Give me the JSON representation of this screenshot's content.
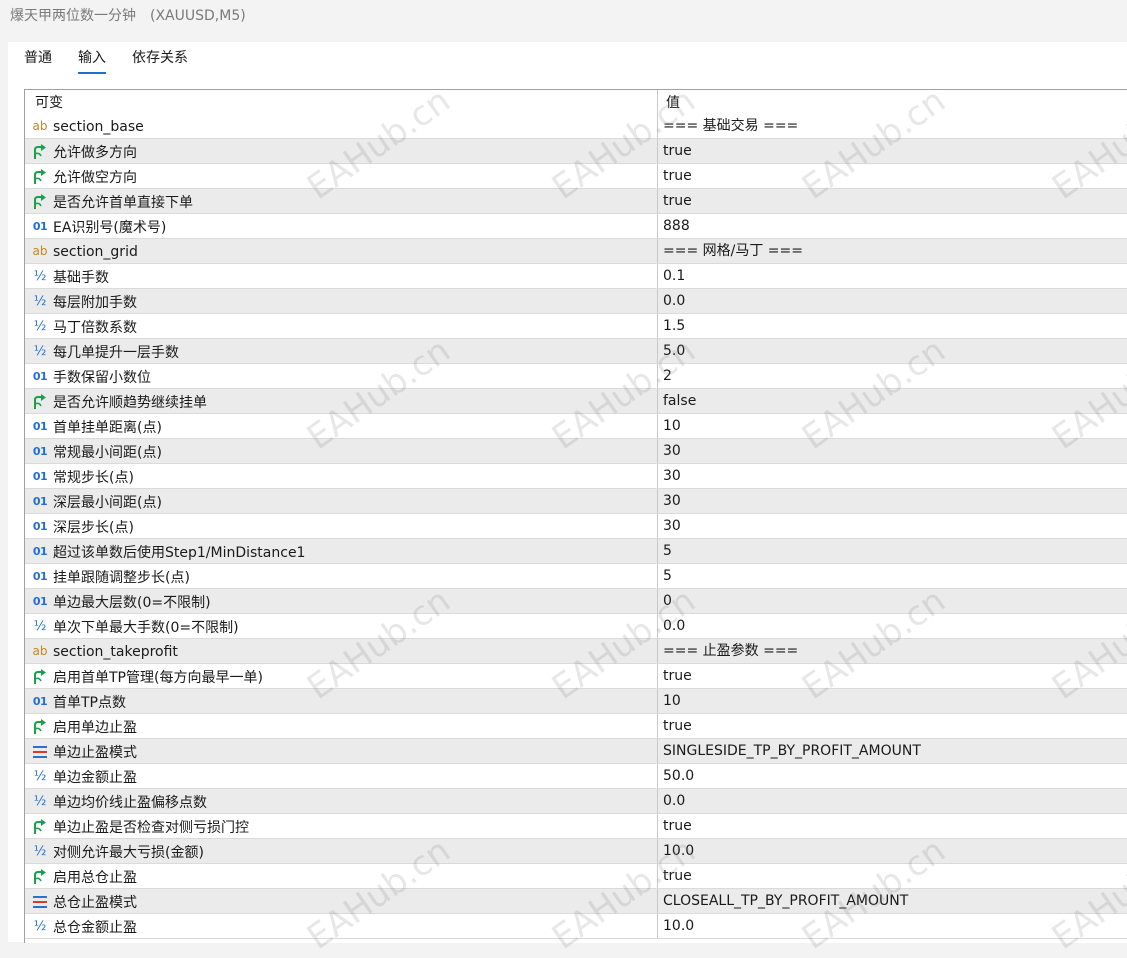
{
  "window": {
    "title": "爆天甲两位数一分钟",
    "symbol": "(XAUUSD,M5)"
  },
  "tabs": [
    {
      "label": "普通",
      "active": false
    },
    {
      "label": "输入",
      "active": true
    },
    {
      "label": "依存关系",
      "active": false
    }
  ],
  "table": {
    "header_variable": "可变",
    "header_value": "值",
    "rows": [
      {
        "icon": "string-icon",
        "name": "section_base",
        "value": "=== 基础交易 ==="
      },
      {
        "icon": "bool-icon",
        "name": "允许做多方向",
        "value": "true"
      },
      {
        "icon": "bool-icon",
        "name": "允许做空方向",
        "value": "true"
      },
      {
        "icon": "bool-icon",
        "name": "是否允许首单直接下单",
        "value": "true"
      },
      {
        "icon": "int-icon",
        "name": "EA识别号(魔术号)",
        "value": "888"
      },
      {
        "icon": "string-icon",
        "name": "section_grid",
        "value": "=== 网格/马丁 ==="
      },
      {
        "icon": "double-icon",
        "name": "基础手数",
        "value": "0.1"
      },
      {
        "icon": "double-icon",
        "name": "每层附加手数",
        "value": "0.0"
      },
      {
        "icon": "double-icon",
        "name": "马丁倍数系数",
        "value": "1.5"
      },
      {
        "icon": "double-icon",
        "name": "每几单提升一层手数",
        "value": "5.0"
      },
      {
        "icon": "int-icon",
        "name": "手数保留小数位",
        "value": "2"
      },
      {
        "icon": "bool-icon",
        "name": "是否允许顺趋势继续挂单",
        "value": "false"
      },
      {
        "icon": "int-icon",
        "name": "首单挂单距离(点)",
        "value": "10"
      },
      {
        "icon": "int-icon",
        "name": "常规最小间距(点)",
        "value": "30"
      },
      {
        "icon": "int-icon",
        "name": "常规步长(点)",
        "value": "30"
      },
      {
        "icon": "int-icon",
        "name": "深层最小间距(点)",
        "value": "30"
      },
      {
        "icon": "int-icon",
        "name": "深层步长(点)",
        "value": "30"
      },
      {
        "icon": "int-icon",
        "name": "超过该单数后使用Step1/MinDistance1",
        "value": "5"
      },
      {
        "icon": "int-icon",
        "name": "挂单跟随调整步长(点)",
        "value": "5"
      },
      {
        "icon": "int-icon",
        "name": "单边最大层数(0=不限制)",
        "value": "0"
      },
      {
        "icon": "double-icon",
        "name": "单次下单最大手数(0=不限制)",
        "value": "0.0"
      },
      {
        "icon": "string-icon",
        "name": "section_takeprofit",
        "value": "=== 止盈参数 ==="
      },
      {
        "icon": "bool-icon",
        "name": "启用首单TP管理(每方向最早一单)",
        "value": "true"
      },
      {
        "icon": "int-icon",
        "name": "首单TP点数",
        "value": "10"
      },
      {
        "icon": "bool-icon",
        "name": "启用单边止盈",
        "value": "true"
      },
      {
        "icon": "enum-icon",
        "name": "单边止盈模式",
        "value": "SINGLESIDE_TP_BY_PROFIT_AMOUNT"
      },
      {
        "icon": "double-icon",
        "name": "单边金额止盈",
        "value": "50.0"
      },
      {
        "icon": "double-icon",
        "name": "单边均价线止盈偏移点数",
        "value": "0.0"
      },
      {
        "icon": "bool-icon",
        "name": "单边止盈是否检查对侧亏损门控",
        "value": "true"
      },
      {
        "icon": "double-icon",
        "name": "对侧允许最大亏损(金额)",
        "value": "10.0"
      },
      {
        "icon": "bool-icon",
        "name": "启用总仓止盈",
        "value": "true"
      },
      {
        "icon": "enum-icon",
        "name": "总仓止盈模式",
        "value": "CLOSEALL_TP_BY_PROFIT_AMOUNT"
      },
      {
        "icon": "double-icon",
        "name": "总仓金额止盈",
        "value": "10.0"
      }
    ]
  },
  "icon_glyphs": {
    "string-icon": "ab",
    "int-icon": "01",
    "double-icon": "½"
  },
  "watermark": "EAHub.cn",
  "colors": {
    "tab_underline": "#1f6fd0",
    "bool_icon": "#1aa14a",
    "int_icon": "#1f6fd0",
    "string_icon": "#c08a1e",
    "enum_icon_red": "#d83a3a",
    "enum_icon_blue": "#2e6fd0",
    "row_alt": "#ebebeb"
  }
}
